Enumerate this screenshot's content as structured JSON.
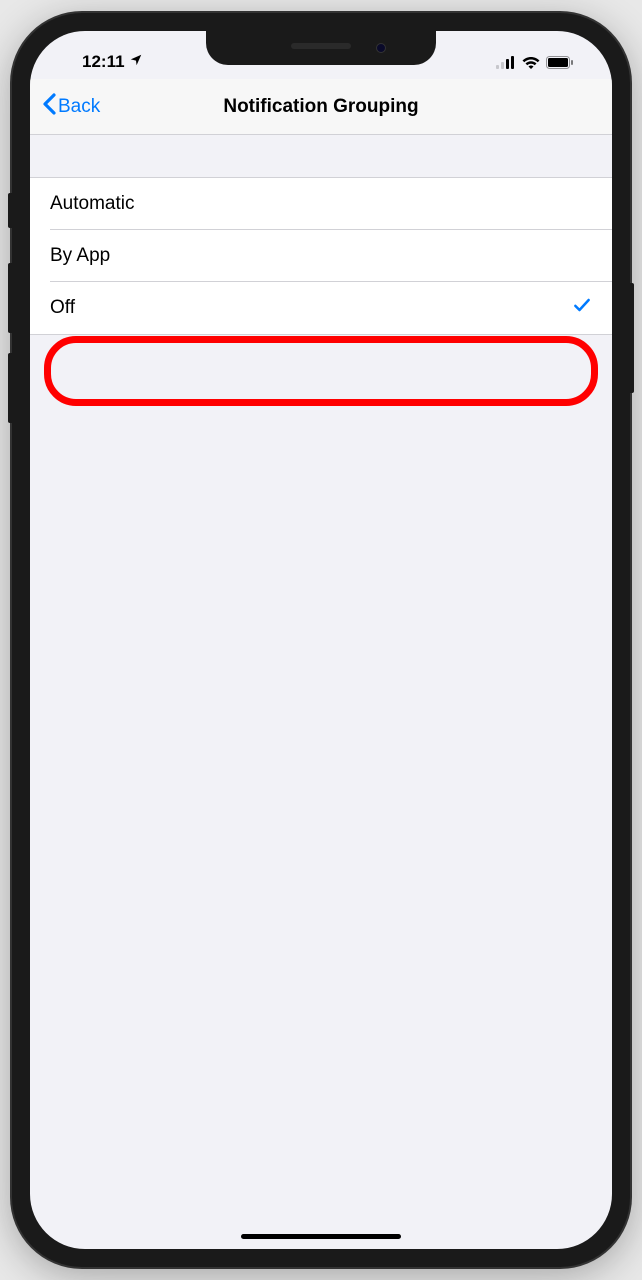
{
  "status": {
    "time": "12:11",
    "location_active": true
  },
  "nav": {
    "back_label": "Back",
    "title": "Notification Grouping"
  },
  "options": [
    {
      "label": "Automatic",
      "selected": false
    },
    {
      "label": "By App",
      "selected": false
    },
    {
      "label": "Off",
      "selected": true
    }
  ],
  "highlight_index": 2,
  "colors": {
    "ios_blue": "#007aff",
    "highlight_red": "#ff0000",
    "background": "#f2f2f7"
  }
}
